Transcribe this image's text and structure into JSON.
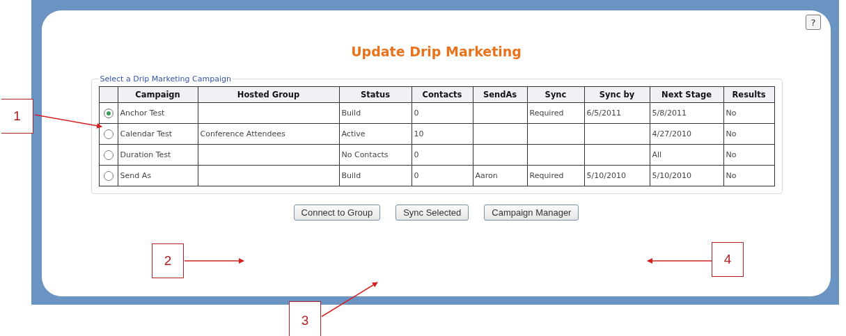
{
  "help_button": {
    "label": "?"
  },
  "title": "Update Drip Marketing",
  "campaign_group": {
    "legend": "Select a Drip Marketing Campaign",
    "columns": [
      "Campaign",
      "Hosted Group",
      "Status",
      "Contacts",
      "SendAs",
      "Sync",
      "Sync by",
      "Next Stage",
      "Results"
    ],
    "rows": [
      {
        "selected": true,
        "cells": [
          "Anchor Test",
          "",
          "Build",
          "0",
          "",
          "Required",
          "6/5/2011",
          "5/8/2011",
          "No"
        ]
      },
      {
        "selected": false,
        "cells": [
          "Calendar Test",
          "Conference Attendees",
          "Active",
          "10",
          "",
          "",
          "",
          "4/27/2010",
          "No"
        ]
      },
      {
        "selected": false,
        "cells": [
          "Duration Test",
          "",
          "No Contacts",
          "0",
          "",
          "",
          "",
          "All",
          "No"
        ]
      },
      {
        "selected": false,
        "cells": [
          "Send As",
          "",
          "Build",
          "0",
          "Aaron",
          "Required",
          "5/10/2010",
          "5/10/2010",
          "No"
        ]
      }
    ]
  },
  "buttons": [
    "Connect to Group",
    "Sync Selected",
    "Campaign Manager"
  ],
  "annotations": [
    {
      "label": "1"
    },
    {
      "label": "2"
    },
    {
      "label": "3"
    },
    {
      "label": "4"
    }
  ]
}
